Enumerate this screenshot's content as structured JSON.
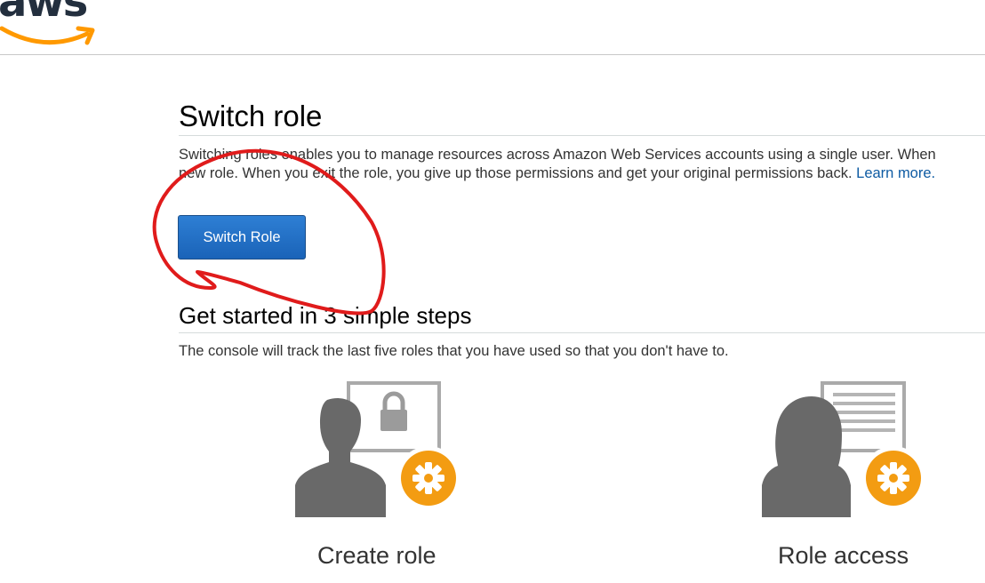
{
  "header": {
    "logo_text": "aws"
  },
  "switch_role": {
    "title": "Switch role",
    "description_line1": "Switching roles enables you to manage resources across Amazon Web Services accounts using a single user. When",
    "description_line2": "new role. When you exit the role, you give up those permissions and get your original permissions back.",
    "learn_more": "Learn more.",
    "button_label": "Switch Role"
  },
  "get_started": {
    "title": "Get started in 3 simple steps",
    "subtitle": "The console will track the last five roles that you have used so that you don't have to.",
    "steps": [
      {
        "label": "Create role",
        "icon": "create-role-icon"
      },
      {
        "label": "Role access",
        "icon": "role-access-icon"
      }
    ]
  },
  "colors": {
    "brand_dark": "#232f3e",
    "brand_orange": "#ff9900",
    "button_blue": "#1a63b8",
    "link_blue": "#0e5ba3",
    "annotation_red": "#e01b1b"
  }
}
